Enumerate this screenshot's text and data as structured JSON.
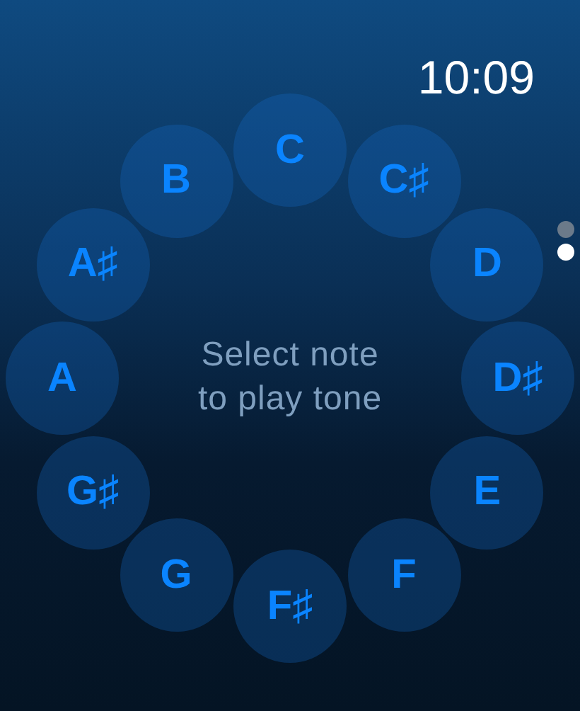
{
  "status_bar": {
    "time": "10:09"
  },
  "page_indicator": [
    {
      "selected": false
    },
    {
      "selected": true
    }
  ],
  "prompt": "Select note\nto play tone",
  "notes": [
    {
      "label": "C"
    },
    {
      "label": "C♯"
    },
    {
      "label": "D"
    },
    {
      "label": "D♯"
    },
    {
      "label": "E"
    },
    {
      "label": "F"
    },
    {
      "label": "F♯"
    },
    {
      "label": "G"
    },
    {
      "label": "G♯"
    },
    {
      "label": "A"
    },
    {
      "label": "A♯"
    },
    {
      "label": "B"
    }
  ]
}
